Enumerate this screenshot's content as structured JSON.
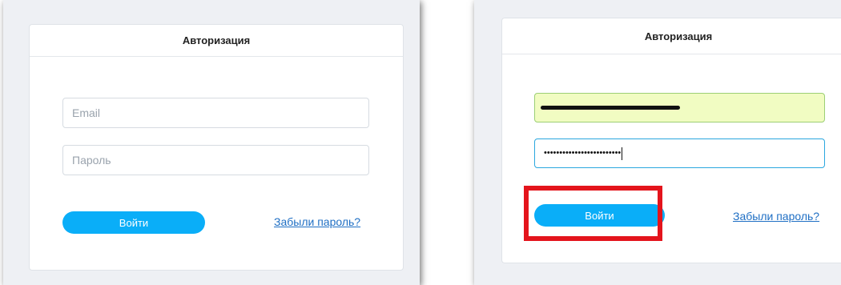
{
  "left_panel": {
    "title": "Авторизация",
    "email": {
      "placeholder": "Email",
      "value": ""
    },
    "password": {
      "placeholder": "Пароль",
      "value": ""
    },
    "login_button": "Войти",
    "forgot_link": "Забыли пароль?"
  },
  "right_panel": {
    "title": "Авторизация",
    "email": {
      "value": "(redacted email)",
      "redacted": true,
      "autofill_color": "#f1fcc2"
    },
    "password": {
      "value": "•••••••••••••••••••••••••"
    },
    "login_button": "Войти",
    "forgot_link": "Забыли пароль?",
    "highlight_color": "#e4141c"
  },
  "colors": {
    "accent": "#0aaef8",
    "link": "#1f6fc4"
  }
}
